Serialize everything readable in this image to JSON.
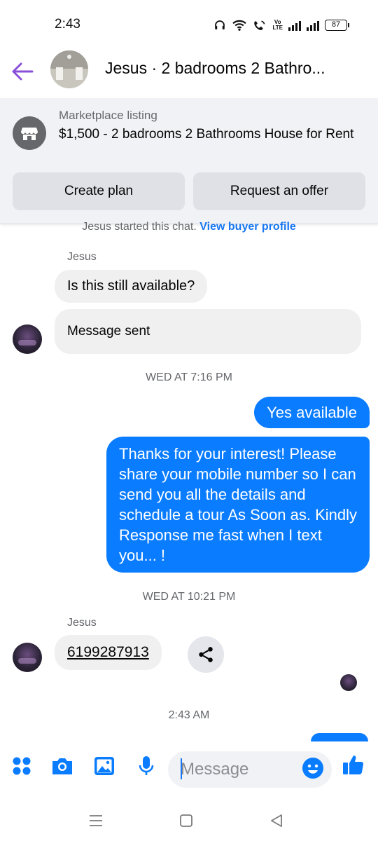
{
  "status_bar": {
    "time": "2:43",
    "battery": "87",
    "volte_label": "Vo\nLTE"
  },
  "header": {
    "title": "Jesus · 2 badrooms 2 Bathro..."
  },
  "marketplace": {
    "label": "Marketplace listing",
    "title": "$1,500 - 2 badrooms 2 Bathrooms House for Rent",
    "buttons": {
      "create_plan": "Create plan",
      "request_offer": "Request an offer"
    }
  },
  "conversation": {
    "started_text": "Jesus started this chat.",
    "buyer_profile_link": "View buyer profile",
    "sender_name_1": "Jesus",
    "msg_1": "Is this still available?",
    "msg_2": "Message sent",
    "timestamp_1": "WED AT 7:16 PM",
    "out_1": "Yes available",
    "out_2": "Thanks for your interest! Please share your mobile number so I can send you all the details and schedule a tour As Soon as. Kindly Response me fast when I text you... !",
    "timestamp_2": "WED AT 10:21 PM",
    "sender_name_2": "Jesus",
    "phone": "6199287913",
    "timestamp_3": "2:43 AM"
  },
  "composer": {
    "placeholder": "Message"
  },
  "colors": {
    "accent": "#0a7cff",
    "link": "#1877f2",
    "back_arrow": "#8a4fd8",
    "incoming_bubble": "#f0f0f0",
    "panel_bg": "#f0f2f5"
  },
  "icons": {
    "composer": [
      "apps-icon",
      "camera-icon",
      "gallery-icon",
      "microphone-icon",
      "emoji-icon",
      "thumbs-up-icon"
    ],
    "navigation": [
      "menu-icon",
      "home-icon",
      "back-icon"
    ]
  }
}
